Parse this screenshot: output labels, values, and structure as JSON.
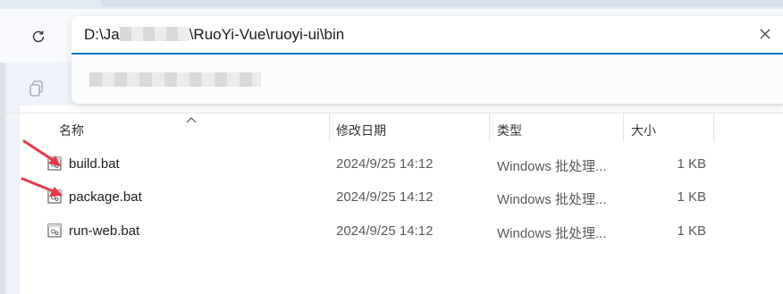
{
  "address_bar": {
    "path_prefix": "D:\\Ja",
    "path_suffix": "\\RuoYi-Vue\\ruoyi-ui\\bin"
  },
  "columns": {
    "name": "名称",
    "modified": "修改日期",
    "type": "类型",
    "size": "大小"
  },
  "files": [
    {
      "name": "build.bat",
      "modified": "2024/9/25 14:12",
      "type": "Windows 批处理...",
      "size": "1 KB"
    },
    {
      "name": "package.bat",
      "modified": "2024/9/25 14:12",
      "type": "Windows 批处理...",
      "size": "1 KB"
    },
    {
      "name": "run-web.bat",
      "modified": "2024/9/25 14:12",
      "type": "Windows 批处理...",
      "size": "1 KB"
    }
  ],
  "colors": {
    "accent": "#1a73c7",
    "annotation_arrow": "#e8394a"
  },
  "icons": [
    "refresh-icon",
    "clear-icon",
    "copy-icon",
    "sort-up-icon",
    "batch-file-icon"
  ]
}
